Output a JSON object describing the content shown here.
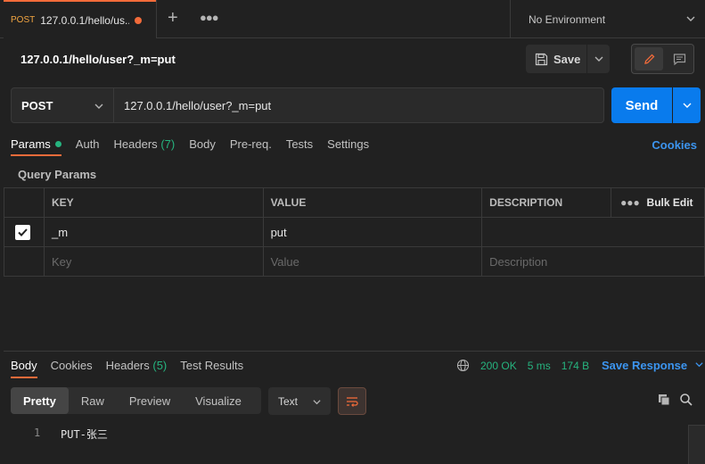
{
  "tab": {
    "method": "POST",
    "title": "127.0.0.1/hello/us..."
  },
  "environment": {
    "label": "No Environment"
  },
  "request": {
    "title": "127.0.0.1/hello/user?_m=put",
    "save_label": "Save",
    "method": "POST",
    "url": "127.0.0.1/hello/user?_m=put",
    "send_label": "Send"
  },
  "req_tabs": {
    "params": "Params",
    "auth": "Auth",
    "headers": "Headers",
    "headers_count": "(7)",
    "body": "Body",
    "prereq": "Pre-req.",
    "tests": "Tests",
    "settings": "Settings",
    "cookies": "Cookies"
  },
  "query_params": {
    "title": "Query Params",
    "columns": {
      "key": "KEY",
      "value": "VALUE",
      "description": "DESCRIPTION",
      "bulk_edit": "Bulk Edit"
    },
    "rows": [
      {
        "key": "_m",
        "value": "put",
        "description": ""
      }
    ],
    "placeholders": {
      "key": "Key",
      "value": "Value",
      "description": "Description"
    }
  },
  "response": {
    "tabs": {
      "body": "Body",
      "cookies": "Cookies",
      "headers": "Headers",
      "headers_count": "(5)",
      "test_results": "Test Results"
    },
    "status": "200 OK",
    "time": "5 ms",
    "size": "174 B",
    "save_response": "Save Response",
    "views": [
      "Pretty",
      "Raw",
      "Preview",
      "Visualize"
    ],
    "format": "Text",
    "lines": [
      {
        "number": "1",
        "text": "PUT-张三"
      }
    ]
  },
  "colors": {
    "accent": "#f26b3a",
    "primary_button": "#097bed",
    "success": "#26b47f",
    "link": "#3c95f0"
  }
}
